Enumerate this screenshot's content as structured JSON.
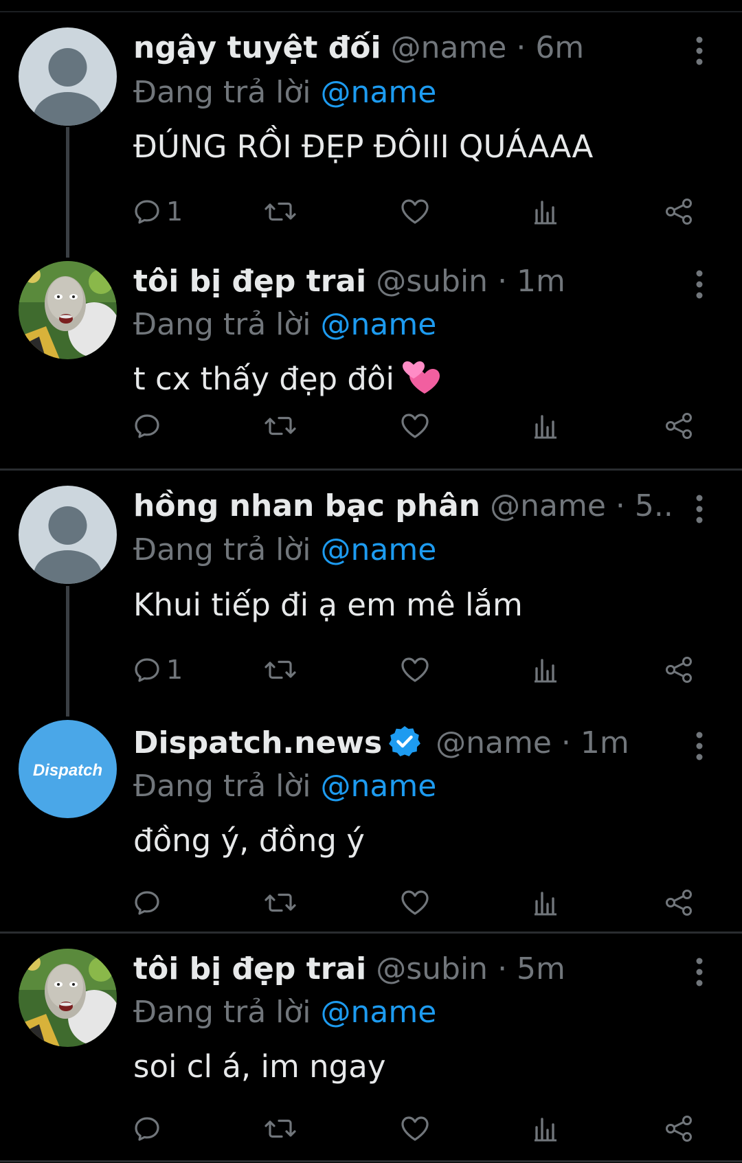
{
  "tweets": [
    {
      "name": "ngậy tuyệt đối",
      "handle": "@name",
      "time": "· 6m",
      "replying_label": "Đang trả lời",
      "replying_to": "@name",
      "text": "ĐÚNG RỒI ĐẸP ĐÔIII QUÁAAA",
      "reply_count": "1",
      "avatar": "default-avatar"
    },
    {
      "name": "tôi bị đẹp trai",
      "handle": "@subin",
      "time": "· 1m",
      "replying_label": "Đang trả lời",
      "replying_to": "@name",
      "text": "t cx thấy đẹp đôi",
      "emoji": "two-hearts-emoji",
      "reply_count": "",
      "avatar": "cartoon-face-avatar"
    },
    {
      "name": "hồng nhan bạc phân",
      "handle": "@name",
      "time": "· 5...",
      "replying_label": "Đang trả lời",
      "replying_to": "@name",
      "text": "Khui tiếp đi ạ em mê lắm",
      "reply_count": "1",
      "avatar": "default-avatar"
    },
    {
      "name": "Dispatch.news",
      "handle": "@name",
      "time": "· 1m",
      "replying_label": "Đang trả lời",
      "replying_to": "@name",
      "text": "đồng ý, đồng ý",
      "reply_count": "",
      "verified": true,
      "avatar": "dispatch-logo-avatar",
      "avatar_logo_text": "Dispatch"
    },
    {
      "name": "tôi bị đẹp trai",
      "handle": "@subin",
      "time": "· 5m",
      "replying_label": "Đang trả lời",
      "replying_to": "@name",
      "text": "soi cl á, im ngay",
      "reply_count": "",
      "avatar": "cartoon-face-avatar"
    }
  ],
  "colors": {
    "background": "#000000",
    "text": "#e7e9ea",
    "secondary": "#71767b",
    "accent": "#1d9bf0",
    "default_avatar_bg": "#ccd6dd",
    "dispatch_blue": "#4aa7e8"
  },
  "icons": [
    "reply-icon",
    "retweet-icon",
    "like-icon",
    "views-icon",
    "share-icon",
    "more-options-icon",
    "verified-badge-icon"
  ]
}
